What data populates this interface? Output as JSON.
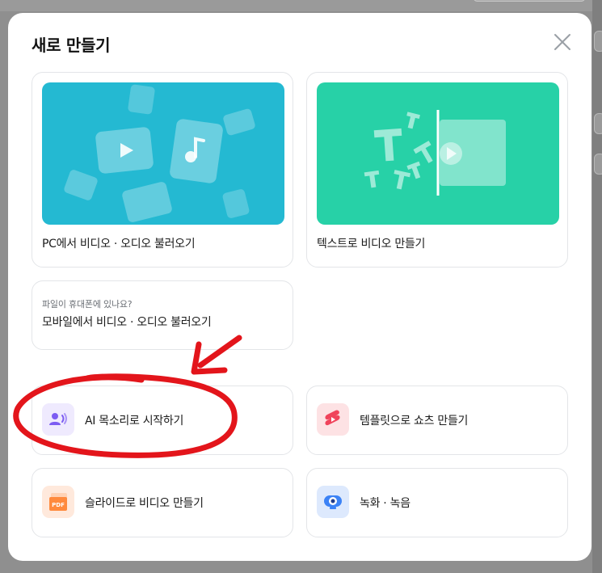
{
  "dialog": {
    "title": "새로 만들기",
    "close_icon": "close-icon"
  },
  "cards": {
    "import_pc": {
      "label": "PC에서 비디오 · 오디오 불러오기",
      "color": "#24b9d2"
    },
    "text_to_video": {
      "label": "텍스트로 비디오 만들기",
      "color": "#27d1a7"
    },
    "mobile_import": {
      "hint": "파일이 휴대폰에 있나요?",
      "label": "모바일에서 비디오 · 오디오 불러오기"
    },
    "ai_voice": {
      "label": "AI 목소리로 시작하기",
      "icon": "ai-voice-icon",
      "color": "#7c5cf2"
    },
    "template_shorts": {
      "label": "템플릿으로 쇼츠 만들기",
      "icon": "shorts-icon",
      "color": "#f0435b"
    },
    "slides_video": {
      "label": "슬라이드로 비디오 만들기",
      "icon": "pdf-icon",
      "icon_text": "PDF",
      "color": "#ff8a3d"
    },
    "record": {
      "label": "녹화 · 녹음",
      "icon": "webcam-icon",
      "color": "#3b82f6"
    }
  },
  "annotation": {
    "color": "#e3151b",
    "shape": "circle-and-arrow",
    "target": "ai_voice"
  }
}
